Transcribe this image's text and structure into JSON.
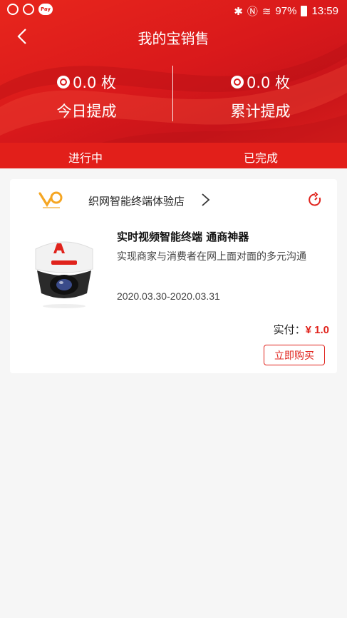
{
  "status_bar": {
    "battery": "97%",
    "time": "13:59",
    "pay_icon_text": "Pay"
  },
  "nav": {
    "title": "我的宝销售"
  },
  "stats": {
    "today_value": "0.0 枚",
    "today_label": "今日提成",
    "total_value": "0.0 枚",
    "total_label": "累计提成"
  },
  "tabs": {
    "active": "进行中",
    "done": "已完成"
  },
  "order": {
    "shop_name": "织网智能终端体验店",
    "product_title": "实时视频智能终端 通商神器",
    "product_desc": "实现商家与消费者在网上面对面的多元沟通",
    "date_range": "2020.03.30-2020.03.31",
    "paid_label": "实付：",
    "paid_amount": "¥ 1.0",
    "buy_label": "立即购买"
  },
  "colors": {
    "brand_red": "#e0231c",
    "background": "#f6f6f6"
  }
}
